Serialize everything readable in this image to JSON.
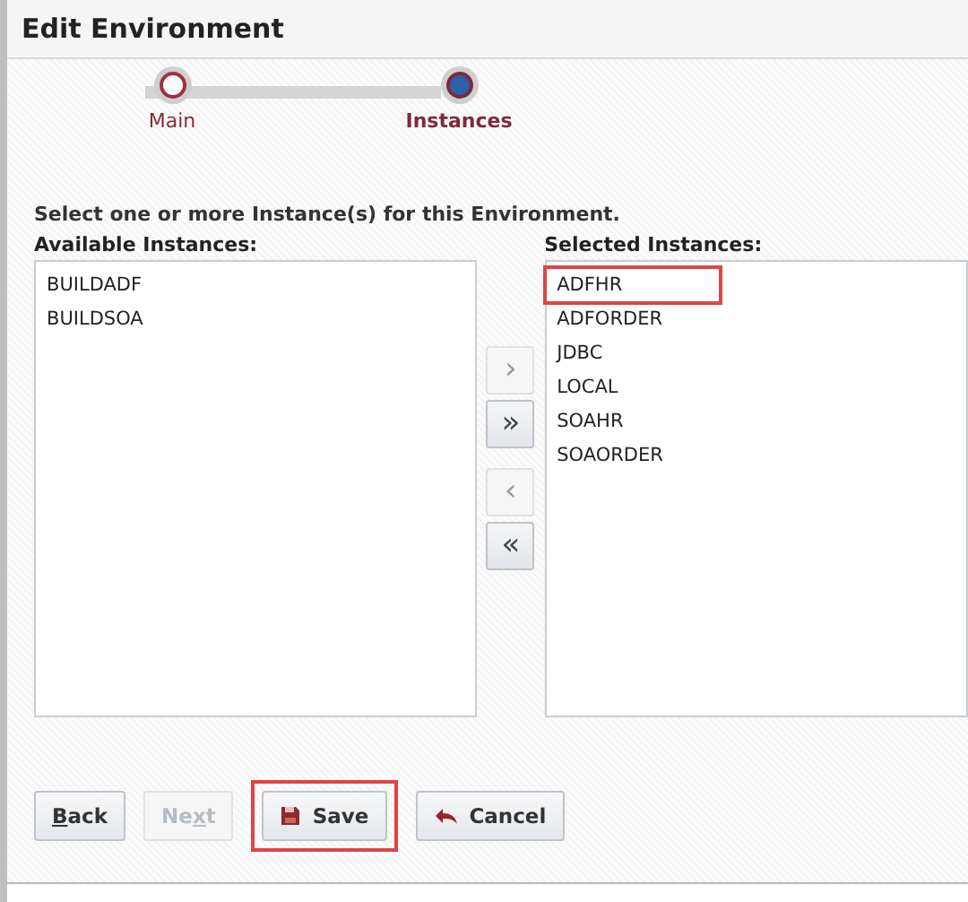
{
  "window": {
    "title": "Edit Environment"
  },
  "train": [
    {
      "label": "Main",
      "selected": false
    },
    {
      "label": "Instances",
      "selected": true
    }
  ],
  "instruction": "Select one or more Instance(s) for this Environment.",
  "available": {
    "label": "Available Instances:",
    "items": [
      {
        "text": "BUILDADF",
        "highlighted": false
      },
      {
        "text": "BUILDSOA",
        "highlighted": false
      }
    ]
  },
  "shuttle_buttons": [
    {
      "symbol": "›",
      "disabled": true
    },
    {
      "symbol": "»",
      "disabled": false
    },
    {
      "symbol": "‹",
      "disabled": true
    },
    {
      "symbol": "«",
      "disabled": false
    }
  ],
  "selected": {
    "label": "Selected Instances:",
    "items": [
      {
        "text": "ADFHR",
        "highlighted": true
      },
      {
        "text": "ADFORDER",
        "highlighted": false
      },
      {
        "text": "JDBC",
        "highlighted": false
      },
      {
        "text": "LOCAL",
        "highlighted": false
      },
      {
        "text": "SOAHR",
        "highlighted": false
      },
      {
        "text": "SOAORDER",
        "highlighted": false
      }
    ]
  },
  "buttons": [
    {
      "kind": "back",
      "access": "B",
      "after": "ack",
      "disabled": false,
      "highlighted": false
    },
    {
      "kind": "next",
      "before": "Ne",
      "access": "x",
      "after": "t",
      "disabled": true,
      "highlighted": false
    },
    {
      "kind": "save",
      "before": "Save",
      "disabled": false,
      "highlighted": true
    },
    {
      "kind": "cancel",
      "before": "Cancel",
      "disabled": false,
      "highlighted": false
    }
  ]
}
